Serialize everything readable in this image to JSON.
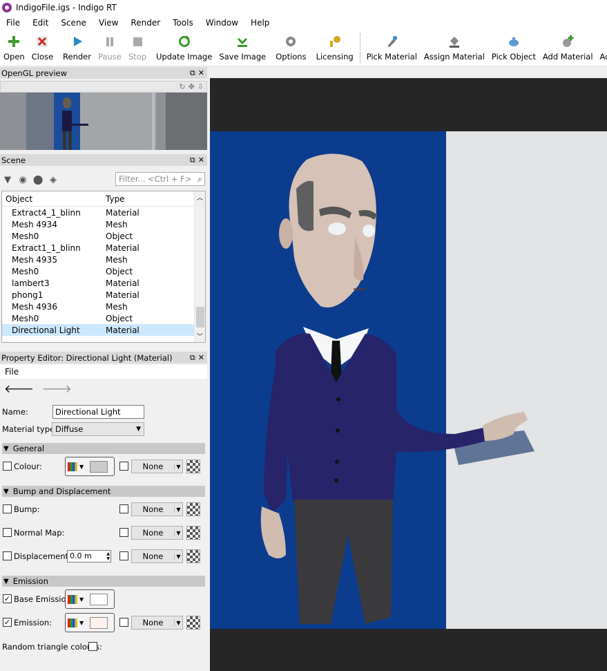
{
  "window": {
    "title": "IndigoFile.igs - Indigo RT"
  },
  "menu": [
    "File",
    "Edit",
    "Scene",
    "View",
    "Render",
    "Tools",
    "Window",
    "Help"
  ],
  "toolbar": {
    "open": "Open",
    "close": "Close",
    "render": "Render",
    "pause": "Pause",
    "stop": "Stop",
    "update_image": "Update Image",
    "save_image": "Save Image",
    "options": "Options",
    "licensing": "Licensing",
    "pick_material": "Pick Material",
    "assign_material": "Assign Material",
    "pick_object": "Pick Object",
    "add_material": "Add Material",
    "add_medium": "Add Medium"
  },
  "colors": {
    "accent": "#8e2f91",
    "selection": "#cce8ff",
    "render_blue": "#0a3a8c"
  },
  "opengl_panel": {
    "title": "OpenGL preview"
  },
  "scene_panel": {
    "title": "Scene",
    "filter_placeholder": "Filter... <Ctrl + F>",
    "columns": {
      "object": "Object",
      "type": "Type"
    },
    "rows": [
      {
        "object": "Extract4_1_blinn",
        "type": "Material"
      },
      {
        "object": "Mesh 4934",
        "type": "Mesh"
      },
      {
        "object": "Mesh0",
        "type": "Object"
      },
      {
        "object": "Extract1_1_blinn",
        "type": "Material"
      },
      {
        "object": "Mesh 4935",
        "type": "Mesh"
      },
      {
        "object": "Mesh0",
        "type": "Object"
      },
      {
        "object": "lambert3",
        "type": "Material"
      },
      {
        "object": "phong1",
        "type": "Material"
      },
      {
        "object": "Mesh 4936",
        "type": "Mesh"
      },
      {
        "object": "Mesh0",
        "type": "Object"
      },
      {
        "object": "Directional Light",
        "type": "Material"
      }
    ],
    "selected_index": 10
  },
  "property_editor": {
    "title": "Property Editor: Directional Light (Material)",
    "menu_file": "File",
    "name_label": "Name:",
    "name_value": "Directional Light",
    "material_type_label": "Material type:",
    "material_type_value": "Diffuse",
    "sections": {
      "general": "General",
      "bump": "Bump and Displacement",
      "emission": "Emission"
    },
    "colour_label": "Colour:",
    "bump_label": "Bump:",
    "normal_map_label": "Normal Map:",
    "displacement_label": "Displacement:",
    "displacement_value": "0.0 m",
    "base_emission_label": "Base Emission:",
    "emission_label": "Emission:",
    "random_triangle_label": "Random triangle colours:",
    "none": "None",
    "checks": {
      "colour": false,
      "bump": false,
      "normal_map": false,
      "displacement": false,
      "base_emission": true,
      "emission": true,
      "random_triangle": false
    }
  }
}
